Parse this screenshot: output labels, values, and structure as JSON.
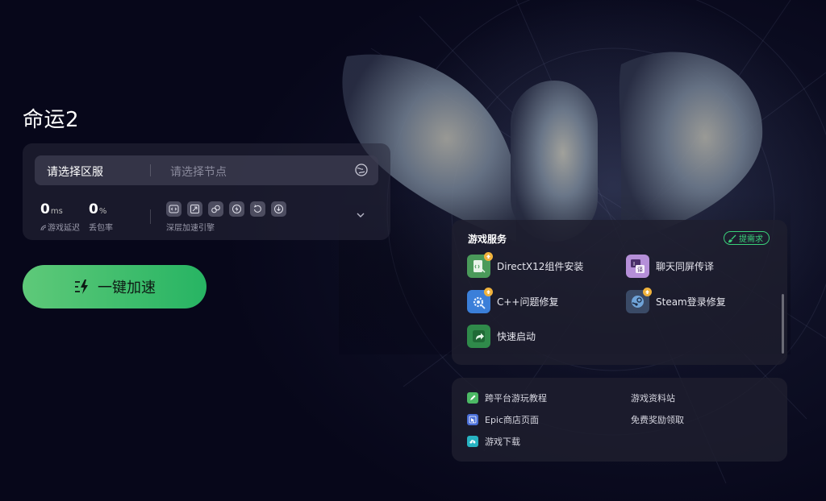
{
  "game": {
    "title": "命运2"
  },
  "server": {
    "region_label": "请选择区服",
    "node_placeholder": "请选择节点"
  },
  "stats": {
    "latency": {
      "value": "0",
      "unit": "ms",
      "label": "游戏延迟"
    },
    "packet_loss": {
      "value": "0",
      "unit": "%",
      "label": "丢包率"
    }
  },
  "engine": {
    "label": "深层加速引擎",
    "icons": [
      "code-icon",
      "window-icon",
      "link-icon",
      "bolt-icon",
      "refresh-icon",
      "download-icon"
    ]
  },
  "boost": {
    "label": "一键加速"
  },
  "services": {
    "title": "游戏服务",
    "request_label": "提需求",
    "items": [
      {
        "label": "DirectX12组件安装",
        "icon": "directx-icon",
        "color": "#4a9a5a"
      },
      {
        "label": "聊天同屏传译",
        "icon": "translate-icon",
        "color": "#b58fd8"
      },
      {
        "label": "C++问题修复",
        "icon": "gear-fix-icon",
        "color": "#3b7fd9"
      },
      {
        "label": "Steam登录修复",
        "icon": "steam-icon",
        "color": "#3a4a66"
      },
      {
        "label": "快速启动",
        "icon": "quick-launch-icon",
        "color": "#2f8a4a"
      }
    ]
  },
  "links": {
    "items": [
      {
        "label": "跨平台游玩教程",
        "icon": "pencil-icon",
        "color": "#4cb965"
      },
      {
        "label": "游戏资料站",
        "icon": "",
        "color": ""
      },
      {
        "label": "Epic商店页面",
        "icon": "cursor-icon",
        "color": "#4a6fd8"
      },
      {
        "label": "免费奖励领取",
        "icon": "",
        "color": ""
      },
      {
        "label": "游戏下载",
        "icon": "cloud-download-icon",
        "color": "#27b3c2"
      }
    ]
  },
  "colors": {
    "accent_green": "#27b463",
    "background": "#07071a"
  }
}
